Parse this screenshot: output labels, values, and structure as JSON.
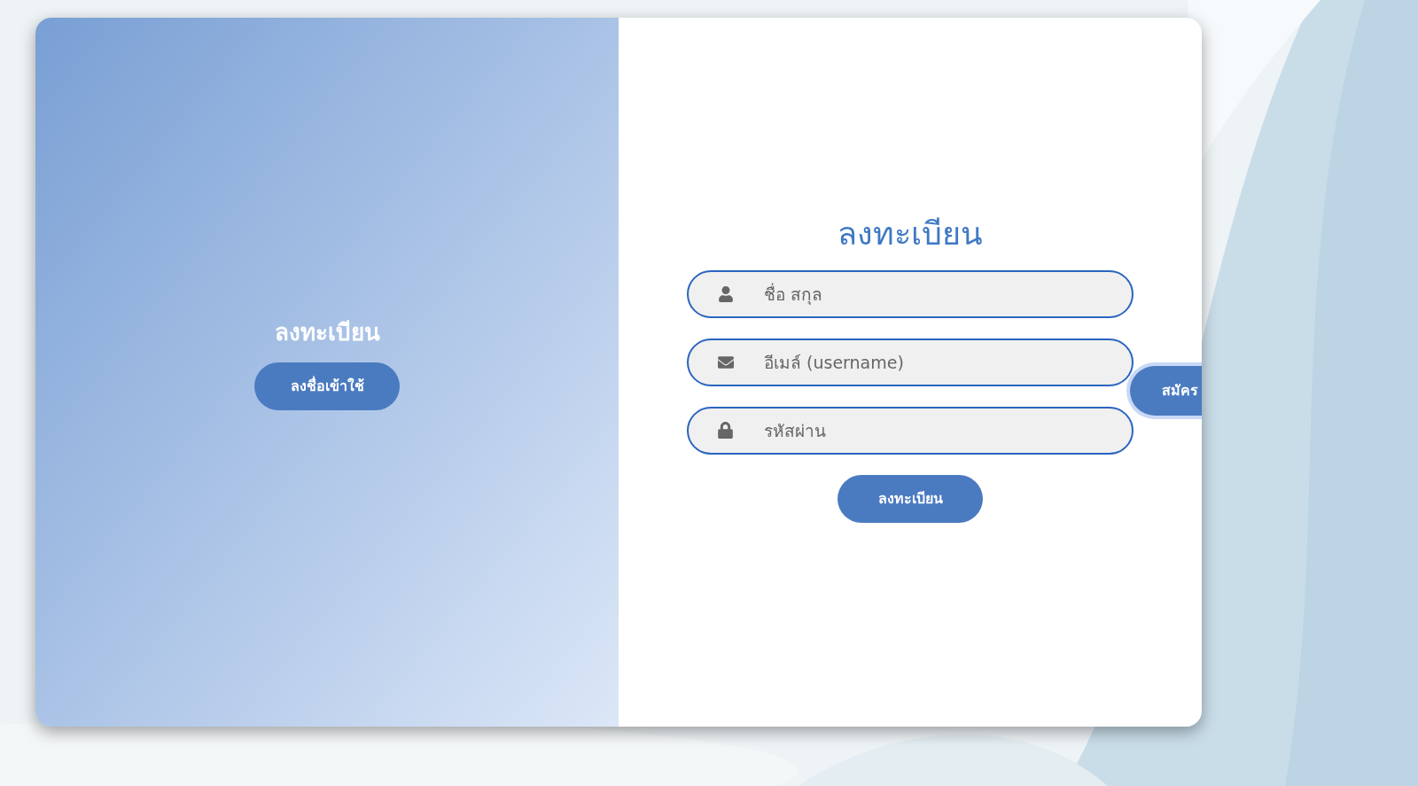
{
  "left_panel": {
    "title": "ลงทะเบียน",
    "button": "ลงชื่อเข้าใช้"
  },
  "form": {
    "title": "ลงทะเบียน",
    "fields": [
      {
        "kind": "name",
        "placeholder": "ชื่อ สกุล"
      },
      {
        "kind": "email",
        "placeholder": "อีเมล์ (username)"
      },
      {
        "kind": "password",
        "placeholder": "รหัสผ่าน"
      }
    ],
    "submit": "ลงทะเบียน"
  },
  "overlay_button": "สมัคร"
}
